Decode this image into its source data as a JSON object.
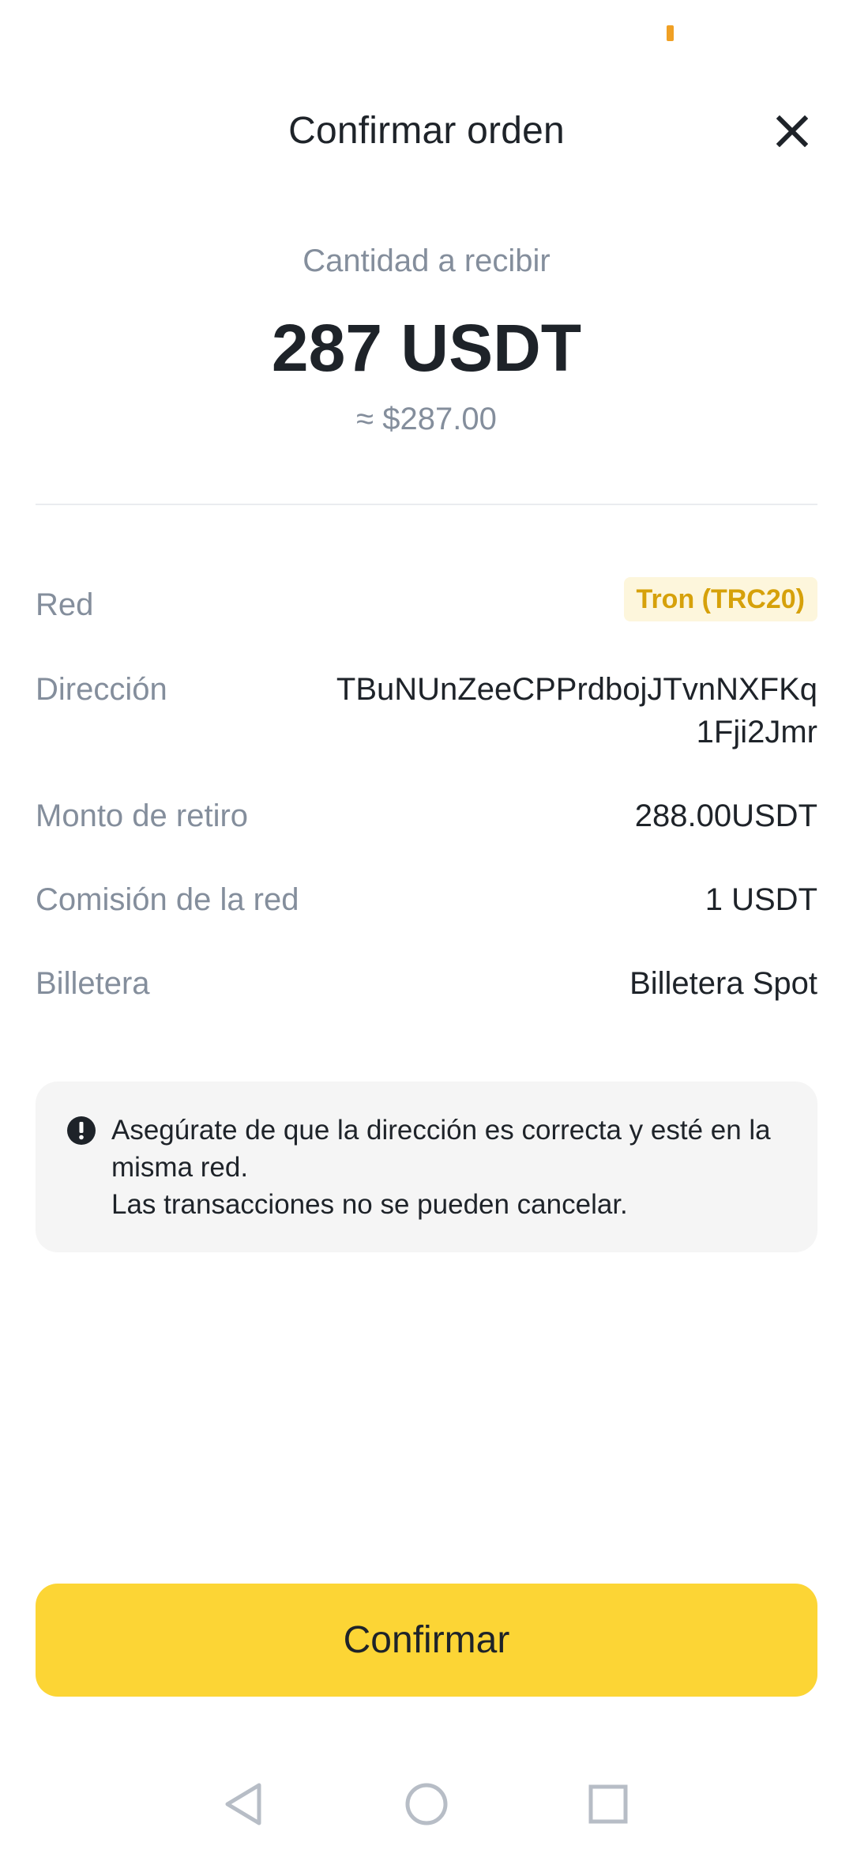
{
  "header": {
    "title": "Confirmar orden"
  },
  "summary": {
    "receive_label": "Cantidad a recibir",
    "receive_amount": "287 USDT",
    "receive_approx": "≈ $287.00"
  },
  "details": [
    {
      "label": "Red",
      "value": "Tron (TRC20)"
    },
    {
      "label": "Dirección",
      "value": "TBuNUnZeeCPPrdbojJTvnNXFKq1Fji2Jmr"
    },
    {
      "label": "Monto de retiro",
      "value": "288.00USDT"
    },
    {
      "label": "Comisión de la red",
      "value": "1 USDT"
    },
    {
      "label": "Billetera",
      "value": "Billetera Spot"
    }
  ],
  "notice": {
    "line1": "Asegúrate de que la dirección es correcta y esté en la misma red.",
    "line2": "Las transacciones no se pueden cancelar.",
    "icon": "exclamation-circle-icon"
  },
  "actions": {
    "confirm_label": "Confirmar"
  },
  "colors": {
    "accent": "#FCD535",
    "badge_text": "#D6A10A",
    "badge_bg": "#FDF6DC",
    "muted_text": "#848E9C",
    "primary_text": "#1E2329",
    "status_indicator": "#F0A024"
  },
  "icons": {
    "close": "close-icon",
    "nav_back": "back-triangle-icon",
    "nav_home": "home-circle-icon",
    "nav_recents": "recents-square-icon"
  }
}
